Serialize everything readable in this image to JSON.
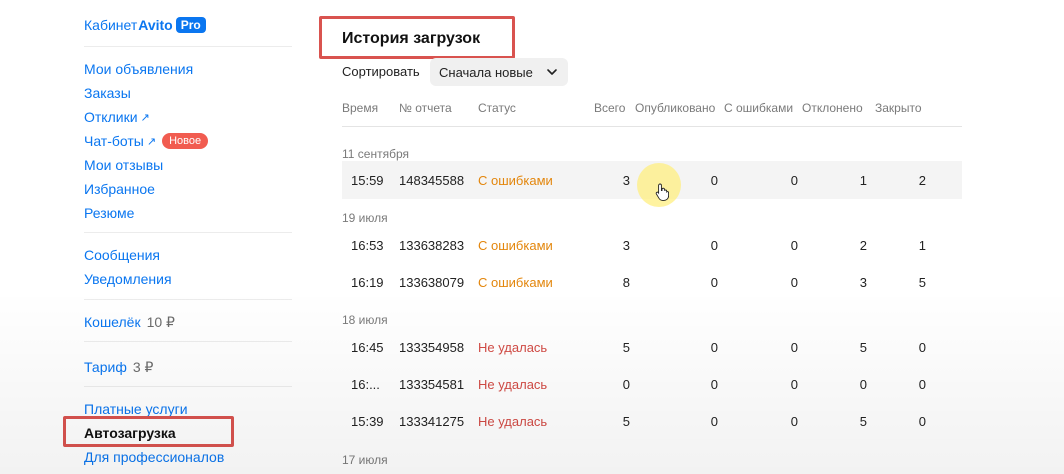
{
  "sidebar": {
    "brand": {
      "kabinet": "Кабинет",
      "avito": "Avito",
      "pro": "Pro"
    },
    "links": [
      {
        "label": "Мои объявления"
      },
      {
        "label": "Заказы"
      },
      {
        "label": "Отклики",
        "arrow": "↗"
      },
      {
        "label": "Чат-боты",
        "arrow": "↗",
        "badge": "Новое"
      },
      {
        "label": "Мои отзывы"
      },
      {
        "label": "Избранное"
      },
      {
        "label": "Резюме"
      }
    ],
    "links2": [
      {
        "label": "Сообщения"
      },
      {
        "label": "Уведомления"
      }
    ],
    "wallet": {
      "label": "Кошелёк",
      "value": "10 ₽"
    },
    "tariff": {
      "label": "Тариф",
      "value": "3 ₽"
    },
    "links3": [
      {
        "label": "Платные услуги"
      },
      {
        "label": "Автозагрузка"
      },
      {
        "label": "Для профессионалов"
      }
    ]
  },
  "main": {
    "title": "История загрузок",
    "sort_label": "Сортировать",
    "sort_value": "Сначала новые",
    "columns": [
      "Время",
      "№ отчета",
      "Статус",
      "Всего",
      "Опубликовано",
      "С ошибками",
      "Отклонено",
      "Закрыто"
    ],
    "groups": [
      {
        "date": "11 сентября",
        "rows": [
          {
            "time": "15:59",
            "report": "148345588",
            "status": "С ошибками",
            "status_kind": "warn",
            "total": "3",
            "published": "0",
            "errors": "0",
            "rejected": "1",
            "closed": "2"
          }
        ]
      },
      {
        "date": "19 июля",
        "rows": [
          {
            "time": "16:53",
            "report": "133638283",
            "status": "С ошибками",
            "status_kind": "warn",
            "total": "3",
            "published": "0",
            "errors": "0",
            "rejected": "2",
            "closed": "1"
          },
          {
            "time": "16:19",
            "report": "133638079",
            "status": "С ошибками",
            "status_kind": "warn",
            "total": "8",
            "published": "0",
            "errors": "0",
            "rejected": "3",
            "closed": "5"
          }
        ]
      },
      {
        "date": "18 июля",
        "rows": [
          {
            "time": "16:45",
            "report": "133354958",
            "status": "Не удалась",
            "status_kind": "fail",
            "total": "5",
            "published": "0",
            "errors": "0",
            "rejected": "5",
            "closed": "0"
          },
          {
            "time": "16:...",
            "report": "133354581",
            "status": "Не удалась",
            "status_kind": "fail",
            "total": "0",
            "published": "0",
            "errors": "0",
            "rejected": "0",
            "closed": "0"
          },
          {
            "time": "15:39",
            "report": "133341275",
            "status": "Не удалась",
            "status_kind": "fail",
            "total": "5",
            "published": "0",
            "errors": "0",
            "rejected": "5",
            "closed": "0"
          }
        ]
      },
      {
        "date": "17 июля",
        "rows": []
      }
    ]
  },
  "colors": {
    "link": "#0a76f0",
    "status_warn": "#e3860c",
    "status_fail": "#d24b45",
    "highlight": "#d9534f",
    "badge": "#f15c50"
  }
}
